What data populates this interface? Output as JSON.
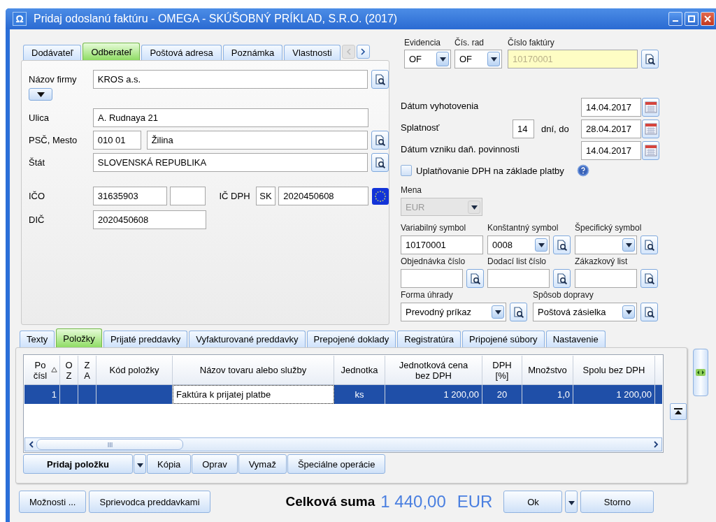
{
  "window": {
    "icon_text": "Ω",
    "title": "Pridaj odoslanú faktúru - OMEGA - SKÚŠOBNÝ PRÍKLAD, S.R.O. (2017)"
  },
  "partner_tabs": [
    {
      "label": "Dodávateľ",
      "selected": false
    },
    {
      "label": "Odberateľ",
      "selected": true
    },
    {
      "label": "Poštová adresa",
      "selected": false
    },
    {
      "label": "Poznámka",
      "selected": false
    },
    {
      "label": "Vlastnosti",
      "selected": false
    }
  ],
  "partner_tabs_scroll": {
    "back_disabled": true,
    "forward_disabled": false
  },
  "partner": {
    "company_name": {
      "label": "Názov firmy",
      "value": "KROS a.s."
    },
    "street": {
      "label": "Ulica",
      "value": "A. Rudnaya 21"
    },
    "city": {
      "label": "PSČ, Mesto",
      "postal_code": "010 01",
      "value": "Žilina"
    },
    "country": {
      "label": "Štát",
      "value": "SLOVENSKÁ REPUBLIKA"
    },
    "ico": {
      "label": "IČO",
      "value": "31635903"
    },
    "ic_dph": {
      "label": "IČ DPH",
      "prefix": "SK",
      "value": "2020450608"
    },
    "dic": {
      "label": "DIČ",
      "value": "2020450608"
    }
  },
  "document": {
    "evidence": {
      "label": "Evidencia",
      "value": "OF"
    },
    "series": {
      "label": "Čís. rad",
      "value": "OF"
    },
    "invoice_number": {
      "label": "Číslo faktúry",
      "value": "10170001"
    }
  },
  "dates": {
    "issue": {
      "label": "Dátum vyhotovenia",
      "value": "14.04.2017"
    },
    "due": {
      "label": "Splatnosť",
      "days": "14",
      "days_label": "dní, do",
      "value": "28.04.2017"
    },
    "tax": {
      "label": "Dátum vzniku daň. povinnosti",
      "value": "14.04.2017"
    }
  },
  "vat_on_payment": {
    "label": "Uplatňovanie DPH na základe platby",
    "checked": false
  },
  "currency": {
    "label": "Mena",
    "value": "EUR",
    "disabled": true
  },
  "symbols": [
    {
      "label": "Variabilný symbol",
      "kind": "text",
      "value": "10170001"
    },
    {
      "label": "Konštantný symbol",
      "kind": "combo",
      "value": "0008"
    },
    {
      "label": "Špecifický symbol",
      "kind": "combo"
    },
    {
      "label": "Objednávka číslo",
      "kind": "lookup"
    },
    {
      "label": "Dodací list číslo",
      "kind": "lookup"
    },
    {
      "label": "Zákazkový list",
      "kind": "lookup"
    }
  ],
  "delivery": [
    {
      "label": "Forma úhrady",
      "value": "Prevodný príkaz"
    },
    {
      "label": "Spôsob dopravy",
      "value": "Poštová zásielka"
    }
  ],
  "item_tabs": [
    {
      "label": "Texty",
      "selected": false
    },
    {
      "label": "Položky",
      "selected": true
    },
    {
      "label": "Prijaté preddavky",
      "selected": false
    },
    {
      "label": "Vyfakturované preddavky",
      "selected": false
    },
    {
      "label": "Prepojené doklady",
      "selected": false
    },
    {
      "label": "Registratúra",
      "selected": false
    },
    {
      "label": "Pripojené súbory",
      "selected": false
    },
    {
      "label": "Nastavenie",
      "selected": false
    }
  ],
  "table": {
    "columns": [
      {
        "label": "Po čísl",
        "sorted": true
      },
      {
        "label": "O Z",
        "sorted": false
      },
      {
        "label": "Z A",
        "sorted": false
      },
      {
        "label": "Kód položky",
        "sorted": false
      },
      {
        "label": "Názov tovaru alebo služby",
        "sorted": false
      },
      {
        "label": "Jednotka",
        "sorted": false
      },
      {
        "label": "Jednotková cena bez DPH",
        "sorted": false
      },
      {
        "label": "DPH [%]",
        "sorted": false
      },
      {
        "label": "Množstvo",
        "sorted": false
      },
      {
        "label": "Spolu bez DPH",
        "sorted": false
      }
    ],
    "rows": [
      {
        "selected": true,
        "cells": [
          {
            "text": "1",
            "editing": false
          },
          {
            "editing": false
          },
          {
            "editing": false
          },
          {
            "editing": false
          },
          {
            "text": "Faktúra k prijatej platbe",
            "editing": true
          },
          {
            "text": "ks",
            "editing": false
          },
          {
            "text": "1 200,00",
            "editing": false
          },
          {
            "text": "20",
            "editing": false
          },
          {
            "text": "1,0",
            "editing": false
          },
          {
            "text": "1 200,00",
            "editing": false
          }
        ]
      }
    ]
  },
  "item_actions": [
    {
      "label": "Pridaj položku",
      "kind": "split"
    },
    {
      "label": "Kópia",
      "kind": "plain"
    },
    {
      "label": "Oprav",
      "kind": "plain"
    },
    {
      "label": "Vymaž",
      "kind": "plain"
    },
    {
      "label": "Špeciálne operácie",
      "kind": "plain"
    }
  ],
  "footer_actions": [
    {
      "label": "Možnosti ..."
    },
    {
      "label": "Sprievodca preddavkami"
    }
  ],
  "total": {
    "label": "Celková suma",
    "amount": "1 440,00",
    "currency": "EUR"
  },
  "dialog_buttons": [
    {
      "label": "Ok",
      "kind": "split"
    },
    {
      "label": "Storno",
      "kind": "plain"
    }
  ]
}
